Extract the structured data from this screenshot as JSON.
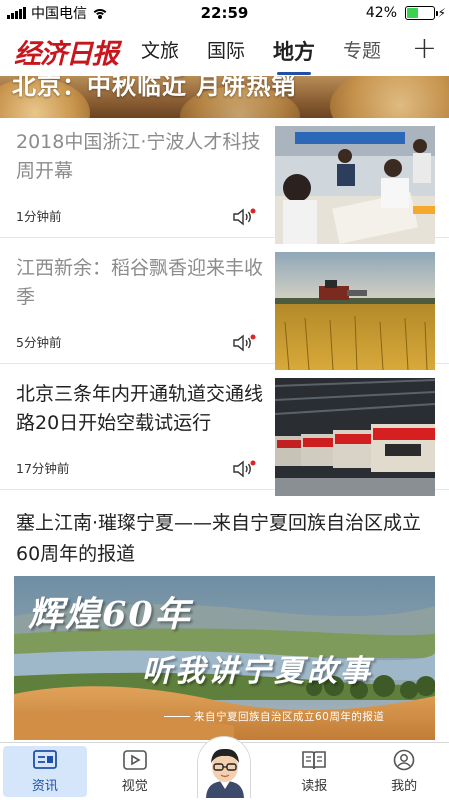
{
  "status_bar": {
    "carrier": "中国电信",
    "time": "22:59",
    "battery_percent": "42%"
  },
  "header": {
    "logo_text": "经济日报",
    "tabs": [
      {
        "label": "文旅",
        "active": false
      },
      {
        "label": "国际",
        "active": false
      },
      {
        "label": "地方",
        "active": true
      },
      {
        "label": "专题",
        "active": false
      }
    ],
    "add_icon": "plus-icon"
  },
  "banner": {
    "text": "北京：中秋临近 月饼热销"
  },
  "articles": [
    {
      "title": "2018中国浙江·宁波人才科技周开幕",
      "time": "1分钟前",
      "read": true
    },
    {
      "title": "江西新余：稻谷飘香迎来丰收季",
      "time": "5分钟前",
      "read": true
    },
    {
      "title": "北京三条年内开通轨道交通线路20日开始空载试运行",
      "time": "17分钟前",
      "read": false
    }
  ],
  "featured": {
    "title": "塞上江南·璀璨宁夏——来自宁夏回族自治区成立60周年的报道",
    "image_caption_1": "辉煌60年",
    "image_caption_2": "听我讲宁夏故事",
    "image_subcaption": "来自宁夏回族自治区成立60周年的报道"
  },
  "tabbar": {
    "items": [
      {
        "label": "资讯",
        "icon": "news-icon",
        "active": true
      },
      {
        "label": "视觉",
        "icon": "video-icon",
        "active": false
      },
      {
        "label": "读报",
        "icon": "newspaper-icon",
        "active": false
      },
      {
        "label": "我的",
        "icon": "profile-icon",
        "active": false
      }
    ]
  },
  "colors": {
    "brand_red": "#c8161d",
    "accent_blue": "#1f4fa7",
    "active_tab_bg": "#d5e6fb",
    "battery_green": "#3bd24e"
  }
}
